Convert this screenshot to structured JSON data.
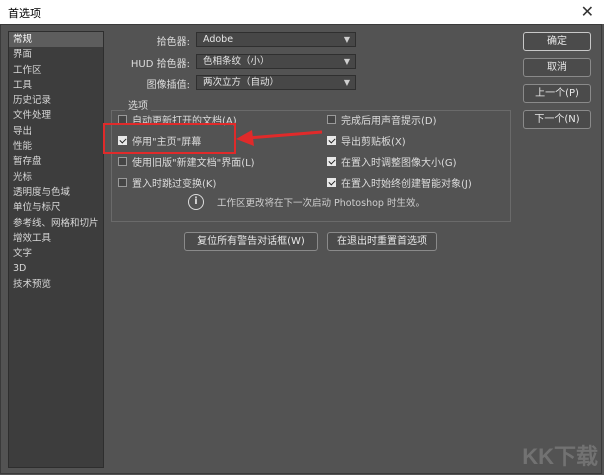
{
  "window": {
    "title": "首选项",
    "close_glyph": "✕"
  },
  "sidebar": {
    "items": [
      {
        "label": "常规",
        "active": true
      },
      {
        "label": "界面"
      },
      {
        "label": "工作区"
      },
      {
        "label": "工具"
      },
      {
        "label": "历史记录"
      },
      {
        "label": "文件处理"
      },
      {
        "label": "导出"
      },
      {
        "label": "性能"
      },
      {
        "label": "暂存盘"
      },
      {
        "label": "光标"
      },
      {
        "label": "透明度与色域"
      },
      {
        "label": "单位与标尺"
      },
      {
        "label": "参考线、网格和切片"
      },
      {
        "label": "增效工具"
      },
      {
        "label": "文字"
      },
      {
        "label": "3D"
      },
      {
        "label": "技术预览"
      }
    ]
  },
  "fields": {
    "color_picker": {
      "label": "拾色器:",
      "value": "Adobe"
    },
    "hud_picker": {
      "label": "HUD 拾色器:",
      "value": "色相条纹（小）"
    },
    "interpolation": {
      "label": "图像插值:",
      "value": "两次立方（自动）"
    }
  },
  "options": {
    "group_title": "选项",
    "left": [
      {
        "label": "自动更新打开的文档(A)",
        "checked": false
      },
      {
        "label": "停用\"主页\"屏幕",
        "checked": true
      },
      {
        "label": "使用旧版\"新建文档\"界面(L)",
        "checked": false
      },
      {
        "label": "置入时跳过变换(K)",
        "checked": false
      }
    ],
    "right": [
      {
        "label": "完成后用声音提示(D)",
        "checked": false
      },
      {
        "label": "导出剪贴板(X)",
        "checked": true
      },
      {
        "label": "在置入时调整图像大小(G)",
        "checked": true
      },
      {
        "label": "在置入时始终创建智能对象(J)",
        "checked": true
      }
    ],
    "info_icon": "i",
    "info_text": "工作区更改将在下一次启动 Photoshop 时生效。"
  },
  "actions": {
    "reset_warnings": "复位所有警告对话框(W)",
    "reset_on_quit": "在退出时重置首选项"
  },
  "buttons": {
    "ok": "确定",
    "cancel": "取消",
    "prev": "上一个(P)",
    "next": "下一个(N)"
  },
  "accent_colors": {
    "highlight": "#e02a2a"
  },
  "watermark": "KK下载"
}
